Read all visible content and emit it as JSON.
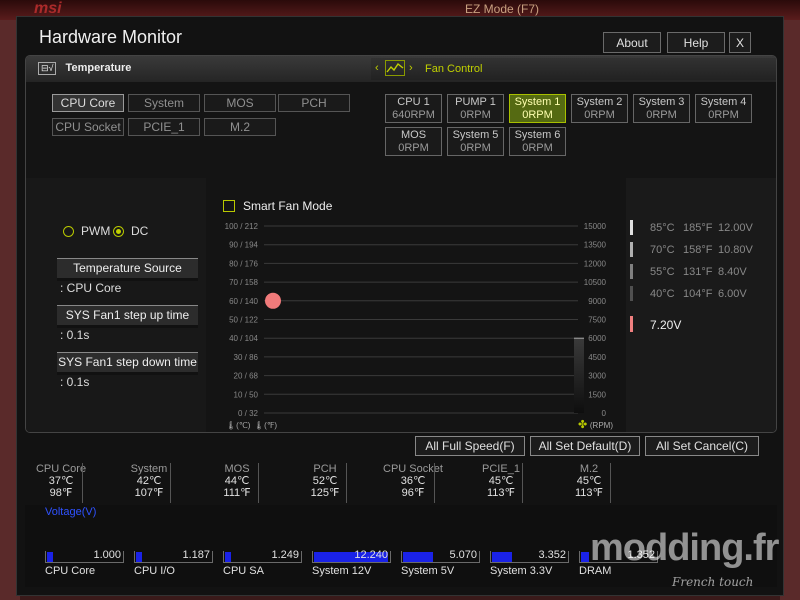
{
  "background": {
    "brand": "msi",
    "mode_label": "EZ Mode (F7)"
  },
  "window": {
    "title": "Hardware Monitor",
    "buttons": {
      "about": "About",
      "help": "Help",
      "close": "X"
    }
  },
  "tabs": {
    "temperature": "Temperature",
    "fan_control": "Fan Control"
  },
  "temp_sources": [
    "CPU Core",
    "System",
    "MOS",
    "PCH",
    "CPU Socket",
    "PCIE_1",
    "M.2"
  ],
  "selected_temp_source": "CPU Core",
  "fans": [
    {
      "name": "CPU 1",
      "rpm": "640RPM",
      "selected": false
    },
    {
      "name": "PUMP 1",
      "rpm": "0RPM",
      "selected": false
    },
    {
      "name": "System 1",
      "rpm": "0RPM",
      "selected": true
    },
    {
      "name": "System 2",
      "rpm": "0RPM",
      "selected": false
    },
    {
      "name": "System 3",
      "rpm": "0RPM",
      "selected": false
    },
    {
      "name": "System 4",
      "rpm": "0RPM",
      "selected": false
    },
    {
      "name": "MOS",
      "rpm": "0RPM",
      "selected": false
    },
    {
      "name": "System 5",
      "rpm": "0RPM",
      "selected": false
    },
    {
      "name": "System 6",
      "rpm": "0RPM",
      "selected": false
    }
  ],
  "control": {
    "pwm_label": "PWM",
    "dc_label": "DC",
    "mode_selected": "DC",
    "temp_source_btn": "Temperature Source",
    "temp_source_val": ": CPU Core",
    "step_up_btn": "SYS Fan1 step up time",
    "step_up_val": ": 0.1s",
    "step_down_btn": "SYS Fan1 step down time",
    "step_down_val": ": 0.1s"
  },
  "chart_data": {
    "type": "line",
    "title": "Smart Fan Mode",
    "smart_fan_enabled": false,
    "y_left_ticks": [
      "100 / 212",
      "90 / 194",
      "80 / 176",
      "70 / 158",
      "60 / 140",
      "50 / 122",
      "40 / 104",
      "30 /  86",
      "20 /  68",
      "10 /  50",
      "0 /  32"
    ],
    "y_right_ticks": [
      "15000",
      "13500",
      "12000",
      "10500",
      "9000",
      "7500",
      "6000",
      "4500",
      "3000",
      "1500",
      "0"
    ],
    "y_left_range": [
      0,
      100
    ],
    "y_right_range": [
      0,
      15000
    ],
    "x_unit_c": "(℃)",
    "x_unit_f": "(℉)",
    "rpm_unit": "(RPM)",
    "current_temperature_c": 37,
    "current_temp_point": {
      "temp_c": 60
    },
    "rpm_indicator": 0,
    "grid": true
  },
  "voltage_levels": [
    {
      "c": "85°C",
      "f": "185°F",
      "v": "12.00V",
      "color": "#e0e0e0"
    },
    {
      "c": "70°C",
      "f": "158°F",
      "v": "10.80V",
      "color": "#b0b0b0"
    },
    {
      "c": "55°C",
      "f": "131°F",
      "v": "8.40V",
      "color": "#808080"
    },
    {
      "c": "40°C",
      "f": "104°F",
      "v": "6.00V",
      "color": "#505050"
    }
  ],
  "current_voltage": {
    "v": "7.20V",
    "color": "#f08080"
  },
  "actions": {
    "full_speed": "All Full Speed(F)",
    "set_default": "All Set Default(D)",
    "set_cancel": "All Set Cancel(C)"
  },
  "temps": [
    {
      "name": "CPU Core",
      "c": "37℃",
      "f": "98℉"
    },
    {
      "name": "System",
      "c": "42℃",
      "f": "107℉"
    },
    {
      "name": "MOS",
      "c": "44℃",
      "f": "111℉"
    },
    {
      "name": "PCH",
      "c": "52℃",
      "f": "125℉"
    },
    {
      "name": "CPU Socket",
      "c": "36℃",
      "f": "96℉"
    },
    {
      "name": "PCIE_1",
      "c": "45℃",
      "f": "113℉"
    },
    {
      "name": "M.2",
      "c": "45℃",
      "f": "113℉"
    }
  ],
  "voltage_section_label": "Voltage(V)",
  "voltages": [
    {
      "name": "CPU Core",
      "value": "1.000",
      "fill_fraction": 0.08
    },
    {
      "name": "CPU I/O",
      "value": "1.187",
      "fill_fraction": 0.08
    },
    {
      "name": "CPU SA",
      "value": "1.249",
      "fill_fraction": 0.08
    },
    {
      "name": "System 12V",
      "value": "12.240",
      "fill_fraction": 0.98
    },
    {
      "name": "System 5V",
      "value": "5.070",
      "fill_fraction": 0.4
    },
    {
      "name": "System 3.3V",
      "value": "3.352",
      "fill_fraction": 0.26
    },
    {
      "name": "DRAM",
      "value": "1.352",
      "fill_fraction": 0.1
    }
  ],
  "watermark": {
    "text": "modding.fr",
    "sub": "French touch"
  }
}
